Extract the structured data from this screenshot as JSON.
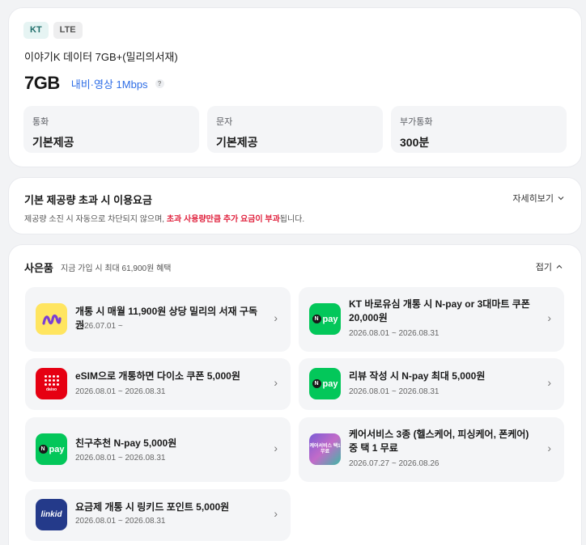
{
  "plan": {
    "badges": [
      "KT",
      "LTE"
    ],
    "name": "이야기K 데이터 7GB+(밀리의서재)",
    "data_amount": "7GB",
    "data_speed": "내비·영상 1Mbps",
    "help_glyph": "?",
    "specs": [
      {
        "label": "통화",
        "value": "기본제공"
      },
      {
        "label": "문자",
        "value": "기본제공"
      },
      {
        "label": "부가통화",
        "value": "300분"
      }
    ]
  },
  "overage": {
    "title": "기본 제공량 초과 시 이용요금",
    "detail_label": "자세히보기",
    "desc_prefix": "제공량 소진 시 자동으로 차단되지 않으며, ",
    "desc_highlight": "초과 사용량만큼 추가 요금이 부과",
    "desc_suffix": "됩니다."
  },
  "gifts": {
    "title": "사은품",
    "subtitle": "지금 가입 시 최대 61,900원 혜택",
    "fold_label": "접기",
    "items": [
      {
        "title": "개통 시 매월 11,900원 상당 밀리의 서재 구독권",
        "date": "2026.07.01 ~",
        "icon": "millie-icon"
      },
      {
        "title": "KT 바로유심 개통 시 N-pay or 3대마트 쿠폰 20,000원",
        "date": "2026.08.01 ~ 2026.08.31",
        "icon": "npay-icon"
      },
      {
        "title": "eSIM으로 개통하면 다이소 쿠폰 5,000원",
        "date": "2026.08.01 ~ 2026.08.31",
        "icon": "daiso-icon"
      },
      {
        "title": "리뷰 작성 시 N-pay 최대 5,000원",
        "date": "2026.08.01 ~ 2026.08.31",
        "icon": "npay-icon"
      },
      {
        "title": "친구추천 N-pay 5,000원",
        "date": "2026.08.01 ~ 2026.08.31",
        "icon": "npay-icon"
      },
      {
        "title": "케어서비스 3종 (헬스케어, 피싱케어, 폰케어) 중 택 1 무료",
        "date": "2026.07.27 ~ 2026.08.26",
        "icon": "care-service-icon"
      },
      {
        "title": "요금제 개통 시 링키드 포인트 5,000원",
        "date": "2026.08.01 ~ 2026.08.31",
        "icon": "linkid-icon"
      }
    ],
    "icon_texts": {
      "npay": "pay",
      "npay_n": "N",
      "daiso": "daiso",
      "care": "케어서비스 택1 무료",
      "linkid": "linkid"
    }
  },
  "colors": {
    "accent_blue": "#2f6ee6",
    "highlight_red": "#e0213d",
    "npay_green": "#03c75a",
    "millie_yellow": "#ffe560",
    "daiso_red": "#e60012",
    "linkid_navy": "#243a8a"
  }
}
